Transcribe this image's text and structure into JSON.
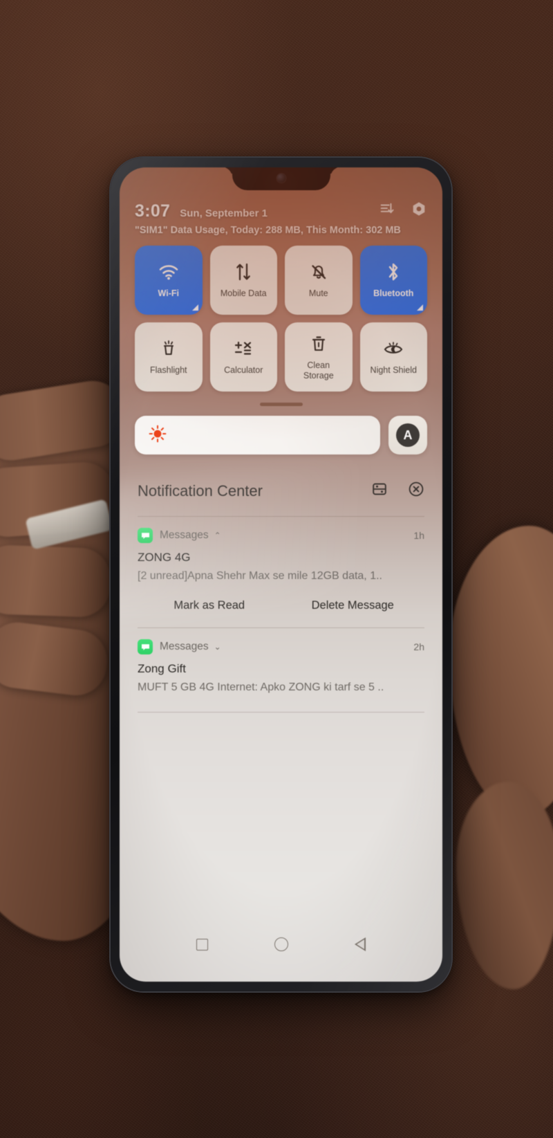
{
  "status_bar": {
    "time": "3:07",
    "date": "Sun, September 1",
    "data_usage": "\"SIM1\" Data Usage, Today: 288 MB, This Month: 302 MB",
    "icons": [
      "sort-list-icon",
      "settings-hex-icon"
    ]
  },
  "quick_settings": {
    "tiles": [
      {
        "label": "Wi-Fi",
        "icon": "wifi-icon",
        "state": "on"
      },
      {
        "label": "Mobile Data",
        "icon": "mobile-data-icon",
        "state": "off"
      },
      {
        "label": "Mute",
        "icon": "bell-mute-icon",
        "state": "off"
      },
      {
        "label": "Bluetooth",
        "icon": "bluetooth-icon",
        "state": "on"
      },
      {
        "label": "Flashlight",
        "icon": "flashlight-icon",
        "state": "off"
      },
      {
        "label": "Calculator",
        "icon": "calculator-icon",
        "state": "off"
      },
      {
        "label": "Clean\nStorage",
        "icon": "trash-clean-icon",
        "state": "off"
      },
      {
        "label": "Night Shield",
        "icon": "night-shield-icon",
        "state": "off"
      }
    ],
    "active_color": "#2f7cf6",
    "inactive_color": "#ece8e1"
  },
  "brightness": {
    "icon": "brightness-sun-icon",
    "level_percent": 100,
    "auto_label": "A"
  },
  "notification_center": {
    "title": "Notification Center",
    "actions": [
      "notification-settings-icon",
      "clear-all-icon"
    ],
    "notifications": [
      {
        "app": "Messages",
        "app_icon": "messages-icon",
        "expanded": true,
        "chevron": "⌃",
        "time": "1h",
        "title": "ZONG 4G",
        "body": "[2 unread]Apna Shehr Max se mile 12GB data, 1..",
        "actions": [
          "Mark as Read",
          "Delete Message"
        ]
      },
      {
        "app": "Messages",
        "app_icon": "messages-icon",
        "expanded": false,
        "chevron": "⌄",
        "time": "2h",
        "title": "Zong Gift",
        "body": "MUFT 5 GB 4G Internet: Apko ZONG ki tarf se 5 ..",
        "actions": []
      }
    ]
  },
  "nav_bar": {
    "buttons": [
      "recents-square-icon",
      "home-circle-icon",
      "back-triangle-icon"
    ]
  }
}
